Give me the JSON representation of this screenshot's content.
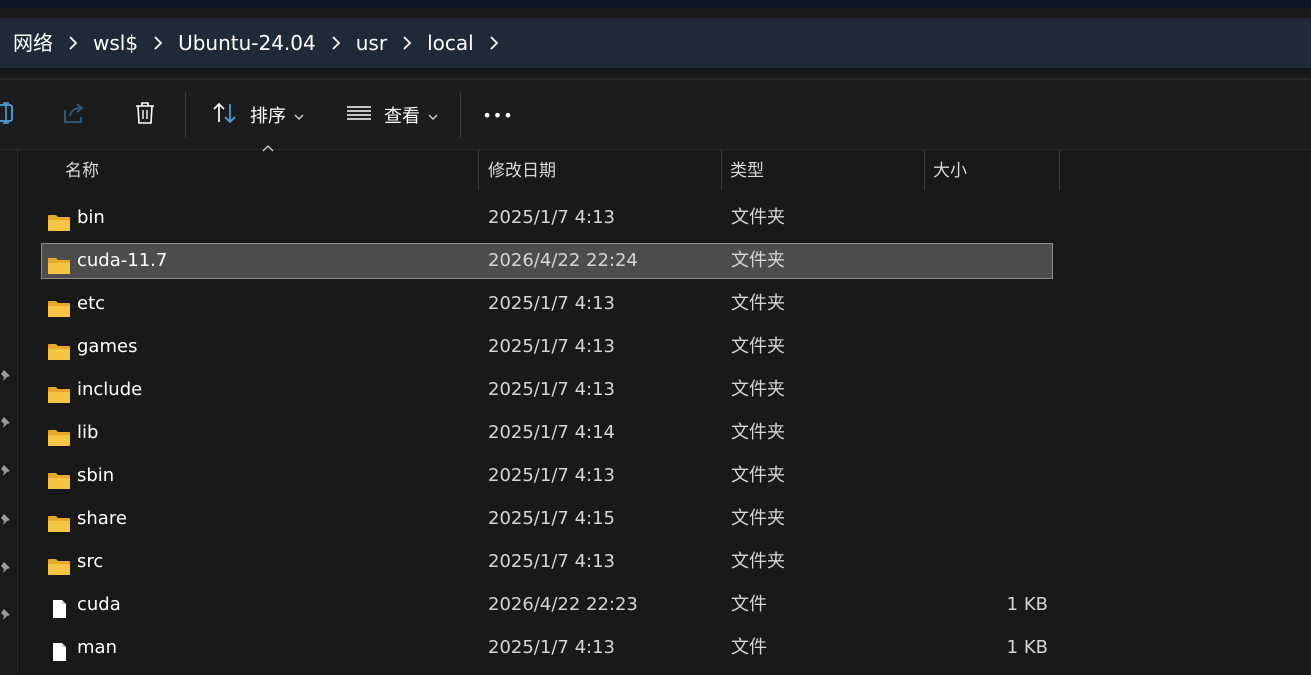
{
  "breadcrumb": {
    "items": [
      {
        "label": "网络"
      },
      {
        "label": "wsl$"
      },
      {
        "label": "Ubuntu-24.04"
      },
      {
        "label": "usr"
      },
      {
        "label": "local"
      }
    ]
  },
  "toolbar": {
    "sort_label": "排序",
    "view_label": "查看",
    "more_label": "•••"
  },
  "columns": {
    "name": "名称",
    "modified": "修改日期",
    "type": "类型",
    "size": "大小"
  },
  "files": [
    {
      "name": "bin",
      "modified": "2025/1/7 4:13",
      "type": "文件夹",
      "size": "",
      "kind": "folder"
    },
    {
      "name": "cuda-11.7",
      "modified": "2026/4/22 22:24",
      "type": "文件夹",
      "size": "",
      "kind": "folder"
    },
    {
      "name": "etc",
      "modified": "2025/1/7 4:13",
      "type": "文件夹",
      "size": "",
      "kind": "folder"
    },
    {
      "name": "games",
      "modified": "2025/1/7 4:13",
      "type": "文件夹",
      "size": "",
      "kind": "folder"
    },
    {
      "name": "include",
      "modified": "2025/1/7 4:13",
      "type": "文件夹",
      "size": "",
      "kind": "folder"
    },
    {
      "name": "lib",
      "modified": "2025/1/7 4:14",
      "type": "文件夹",
      "size": "",
      "kind": "folder"
    },
    {
      "name": "sbin",
      "modified": "2025/1/7 4:13",
      "type": "文件夹",
      "size": "",
      "kind": "folder"
    },
    {
      "name": "share",
      "modified": "2025/1/7 4:15",
      "type": "文件夹",
      "size": "",
      "kind": "folder"
    },
    {
      "name": "src",
      "modified": "2025/1/7 4:13",
      "type": "文件夹",
      "size": "",
      "kind": "folder"
    },
    {
      "name": "cuda",
      "modified": "2026/4/22 22:23",
      "type": "文件",
      "size": "1 KB",
      "kind": "file"
    },
    {
      "name": "man",
      "modified": "2025/1/7 4:13",
      "type": "文件",
      "size": "1 KB",
      "kind": "file"
    }
  ],
  "selected_row": "cuda-11.7",
  "colors": {
    "background": "#191919",
    "address_bar": "#202938",
    "selection": "#4d4d4d",
    "folder": "#f7c544",
    "accent": "#4aa3df"
  }
}
